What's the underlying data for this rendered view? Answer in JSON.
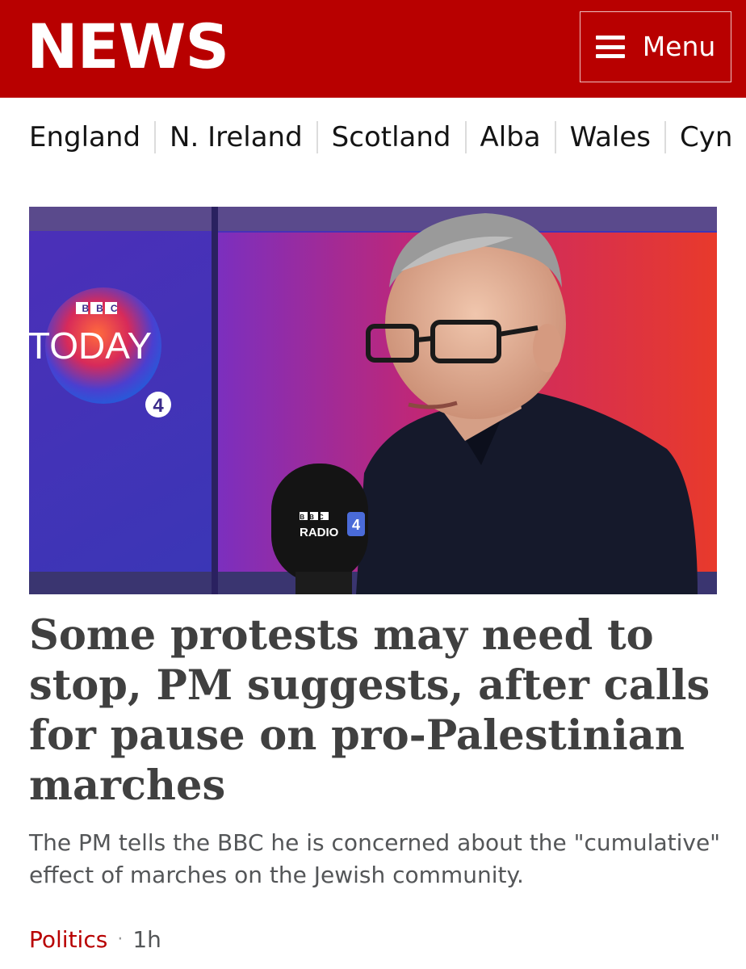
{
  "header": {
    "logo": "NEWS",
    "menu_label": "Menu"
  },
  "nations": [
    "England",
    "N. Ireland",
    "Scotland",
    "Alba",
    "Wales",
    "Cyn"
  ],
  "hero": {
    "programme_brand": "BBC",
    "programme_name": "TODAY",
    "station_number": "4",
    "mic_brand": "BBC",
    "mic_label": "RADIO",
    "mic_number": "4"
  },
  "article": {
    "headline": "Some protests may need to stop, PM suggests, after calls for pause on pro-Palestinian marches",
    "summary": "The PM tells the BBC he is concerned about the \"cumulative\" effect of marches on the Jewish community.",
    "tag": "Politics",
    "separator": "·",
    "age": "1h"
  },
  "colors": {
    "brand_red": "#b80000",
    "headline_grey": "#404040",
    "summary_grey": "#545658"
  }
}
